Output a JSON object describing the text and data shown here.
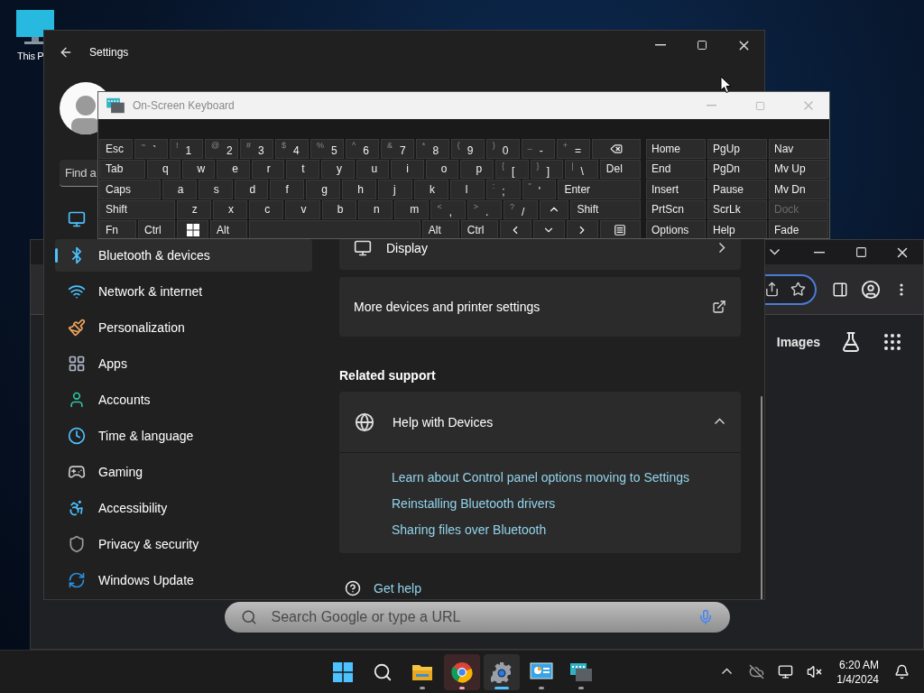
{
  "desktop": {
    "icons": [
      {
        "label": "This P"
      }
    ]
  },
  "chrome_window": {
    "new_tab": {
      "links": [
        "Images"
      ],
      "search": {
        "placeholder": "Search Google or type a URL"
      }
    }
  },
  "settings_window": {
    "title": "Settings",
    "search": {
      "placeholder": "Find a"
    },
    "nav": [
      {
        "label": "Bluetooth & devices",
        "selected": true
      },
      {
        "label": "Network & internet",
        "selected": false
      },
      {
        "label": "Personalization",
        "selected": false
      },
      {
        "label": "Apps",
        "selected": false
      },
      {
        "label": "Accounts",
        "selected": false
      },
      {
        "label": "Time & language",
        "selected": false
      },
      {
        "label": "Gaming",
        "selected": false
      },
      {
        "label": "Accessibility",
        "selected": false
      },
      {
        "label": "Privacy & security",
        "selected": false
      },
      {
        "label": "Windows Update",
        "selected": false
      }
    ],
    "cards": [
      {
        "label": "Display",
        "kind": "nav"
      },
      {
        "label": "More devices and printer settings",
        "kind": "external"
      }
    ],
    "related_support": {
      "heading": "Related support",
      "items": [
        {
          "title": "Help with Devices",
          "expanded": true,
          "links": [
            "Learn about Control panel options moving to Settings",
            "Reinstalling Bluetooth drivers",
            "Sharing files over Bluetooth"
          ]
        }
      ]
    },
    "get_help": "Get help"
  },
  "keyboard": {
    "title": "On-Screen Keyboard",
    "rows": [
      [
        {
          "kind": "label",
          "main": "Esc"
        },
        {
          "kind": "char",
          "shift": "~",
          "main": "`"
        },
        {
          "kind": "char",
          "shift": "!",
          "main": "1"
        },
        {
          "kind": "char",
          "shift": "@",
          "main": "2"
        },
        {
          "kind": "char",
          "shift": "#",
          "main": "3"
        },
        {
          "kind": "char",
          "shift": "$",
          "main": "4"
        },
        {
          "kind": "char",
          "shift": "%",
          "main": "5"
        },
        {
          "kind": "char",
          "shift": "^",
          "main": "6"
        },
        {
          "kind": "char",
          "shift": "&",
          "main": "7"
        },
        {
          "kind": "char",
          "shift": "*",
          "main": "8"
        },
        {
          "kind": "char",
          "shift": "(",
          "main": "9"
        },
        {
          "kind": "char",
          "shift": ")",
          "main": "0"
        },
        {
          "kind": "char",
          "shift": "_",
          "main": "-"
        },
        {
          "kind": "char",
          "shift": "+",
          "main": "="
        },
        {
          "kind": "backspace"
        }
      ],
      [
        {
          "kind": "label",
          "main": "Tab"
        },
        {
          "kind": "char",
          "main": "q"
        },
        {
          "kind": "char",
          "main": "w"
        },
        {
          "kind": "char",
          "main": "e"
        },
        {
          "kind": "char",
          "main": "r"
        },
        {
          "kind": "char",
          "main": "t"
        },
        {
          "kind": "char",
          "main": "y"
        },
        {
          "kind": "char",
          "main": "u"
        },
        {
          "kind": "char",
          "main": "i"
        },
        {
          "kind": "char",
          "main": "o"
        },
        {
          "kind": "char",
          "main": "p"
        },
        {
          "kind": "char",
          "shift": "{",
          "main": "["
        },
        {
          "kind": "char",
          "shift": "}",
          "main": "]"
        },
        {
          "kind": "char",
          "shift": "|",
          "main": "\\"
        },
        {
          "kind": "label",
          "main": "Del"
        }
      ],
      [
        {
          "kind": "label",
          "main": "Caps"
        },
        {
          "kind": "char",
          "main": "a"
        },
        {
          "kind": "char",
          "main": "s"
        },
        {
          "kind": "char",
          "main": "d"
        },
        {
          "kind": "char",
          "main": "f"
        },
        {
          "kind": "char",
          "main": "g"
        },
        {
          "kind": "char",
          "main": "h"
        },
        {
          "kind": "char",
          "main": "j"
        },
        {
          "kind": "char",
          "main": "k"
        },
        {
          "kind": "char",
          "main": "l"
        },
        {
          "kind": "char",
          "shift": ":",
          "main": ";"
        },
        {
          "kind": "char",
          "shift": "\"",
          "main": "'"
        },
        {
          "kind": "label",
          "main": "Enter"
        }
      ],
      [
        {
          "kind": "label",
          "main": "Shift"
        },
        {
          "kind": "char",
          "main": "z"
        },
        {
          "kind": "char",
          "main": "x"
        },
        {
          "kind": "char",
          "main": "c"
        },
        {
          "kind": "char",
          "main": "v"
        },
        {
          "kind": "char",
          "main": "b"
        },
        {
          "kind": "char",
          "main": "n"
        },
        {
          "kind": "char",
          "main": "m"
        },
        {
          "kind": "char",
          "shift": "<",
          "main": ","
        },
        {
          "kind": "char",
          "shift": ">",
          "main": "."
        },
        {
          "kind": "char",
          "shift": "?",
          "main": "/"
        },
        {
          "kind": "up"
        },
        {
          "kind": "label",
          "main": "Shift"
        }
      ],
      [
        {
          "kind": "label",
          "main": "Fn"
        },
        {
          "kind": "label",
          "main": "Ctrl"
        },
        {
          "kind": "win"
        },
        {
          "kind": "label",
          "main": "Alt"
        },
        {
          "kind": "space"
        },
        {
          "kind": "label",
          "main": "Alt"
        },
        {
          "kind": "label",
          "main": "Ctrl"
        },
        {
          "kind": "left"
        },
        {
          "kind": "down"
        },
        {
          "kind": "right"
        },
        {
          "kind": "menu"
        }
      ]
    ],
    "nav_keys": [
      [
        {
          "label": "Home",
          "disabled": false
        },
        {
          "label": "PgUp",
          "disabled": false
        },
        {
          "label": "Nav",
          "disabled": false
        }
      ],
      [
        {
          "label": "End",
          "disabled": false
        },
        {
          "label": "PgDn",
          "disabled": false
        },
        {
          "label": "Mv Up",
          "disabled": false
        }
      ],
      [
        {
          "label": "Insert",
          "disabled": false
        },
        {
          "label": "Pause",
          "disabled": false
        },
        {
          "label": "Mv Dn",
          "disabled": false
        }
      ],
      [
        {
          "label": "PrtScn",
          "disabled": false
        },
        {
          "label": "ScrLk",
          "disabled": false
        },
        {
          "label": "Dock",
          "disabled": true
        }
      ],
      [
        {
          "label": "Options",
          "disabled": false
        },
        {
          "label": "Help",
          "disabled": false
        },
        {
          "label": "Fade",
          "disabled": false
        }
      ]
    ]
  },
  "taskbar": {
    "apps": [
      {
        "running": false,
        "selected": false,
        "flashing": false
      },
      {
        "running": false,
        "selected": false,
        "flashing": false
      },
      {
        "running": true,
        "selected": false,
        "flashing": false
      },
      {
        "running": true,
        "selected": false,
        "flashing": true
      },
      {
        "running": true,
        "selected": true,
        "flashing": false
      },
      {
        "running": true,
        "selected": false,
        "flashing": false
      },
      {
        "running": true,
        "selected": false,
        "flashing": false
      }
    ],
    "time": "6:20 AM",
    "date": "1/4/2024"
  }
}
